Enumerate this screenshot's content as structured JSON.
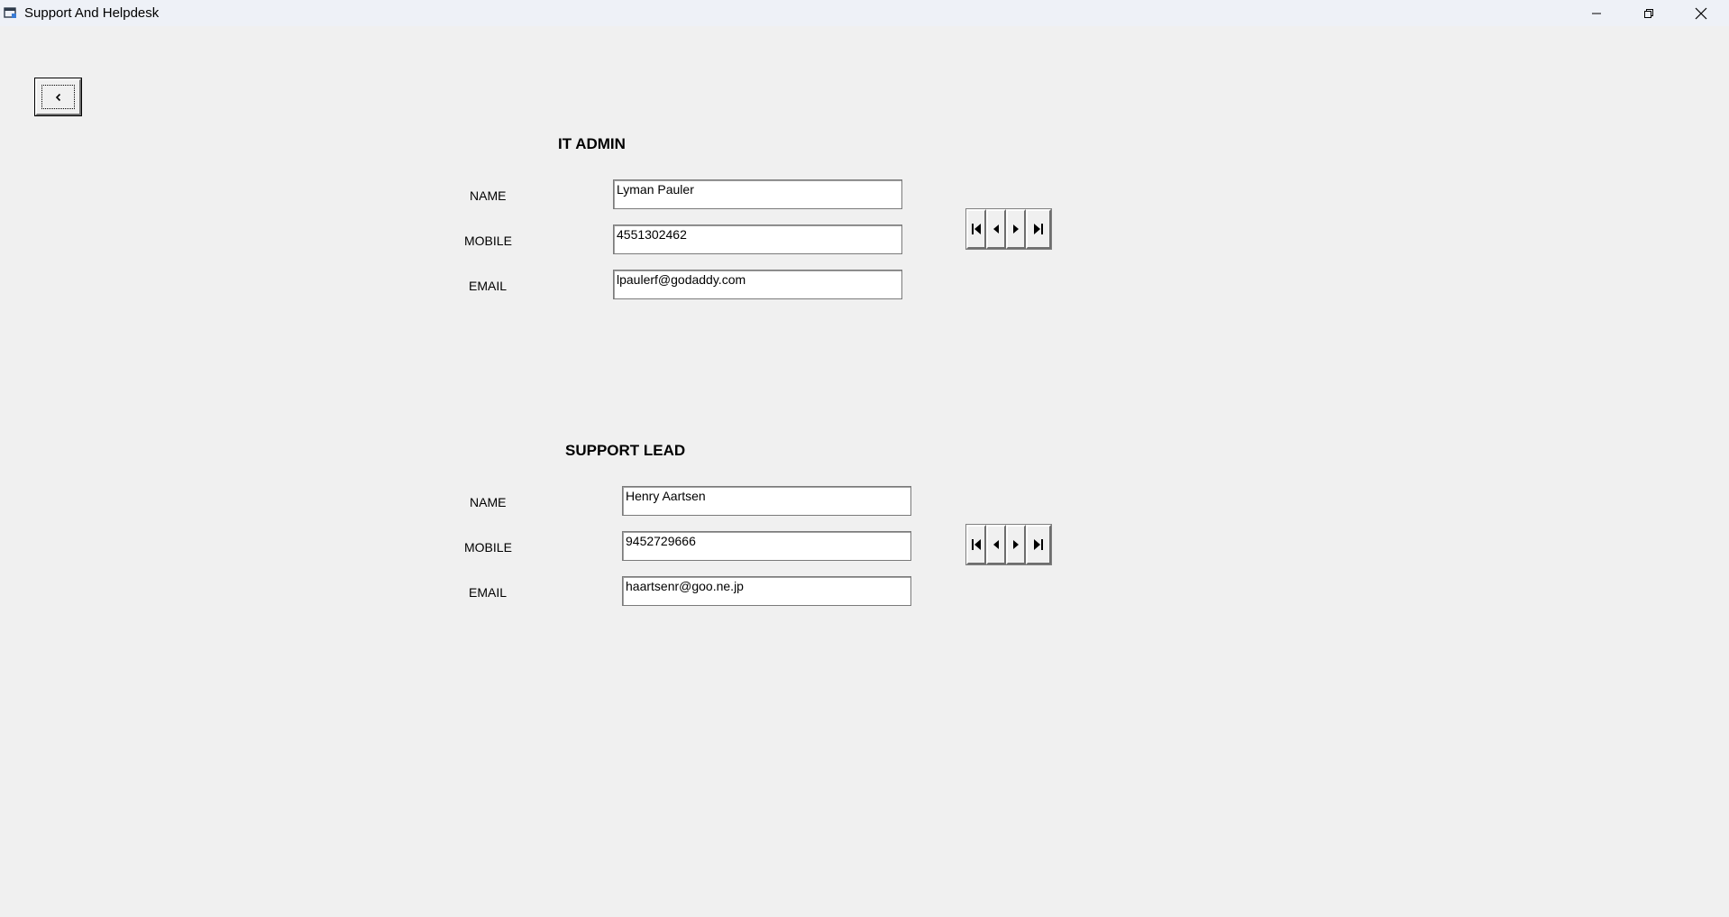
{
  "window": {
    "title": "Support And Helpdesk"
  },
  "icons": {
    "app": "app-window-icon",
    "minimize": "minimize-icon",
    "maximize": "restore-icon",
    "close": "close-icon",
    "back": "chevron-left-icon",
    "first": "first-record-icon",
    "prev": "previous-record-icon",
    "next": "next-record-icon",
    "last": "last-record-icon"
  },
  "it_admin": {
    "title": "IT ADMIN",
    "name_label": "NAME",
    "mobile_label": "MOBILE",
    "email_label": "EMAIL",
    "name_value": "Lyman Pauler",
    "mobile_value": "4551302462",
    "email_value": "lpaulerf@godaddy.com"
  },
  "support_lead": {
    "title": "SUPPORT LEAD",
    "name_label": "NAME",
    "mobile_label": "MOBILE",
    "email_label": "EMAIL",
    "name_value": "Henry Aartsen",
    "mobile_value": "9452729666",
    "email_value": "haartsenr@goo.ne.jp"
  }
}
